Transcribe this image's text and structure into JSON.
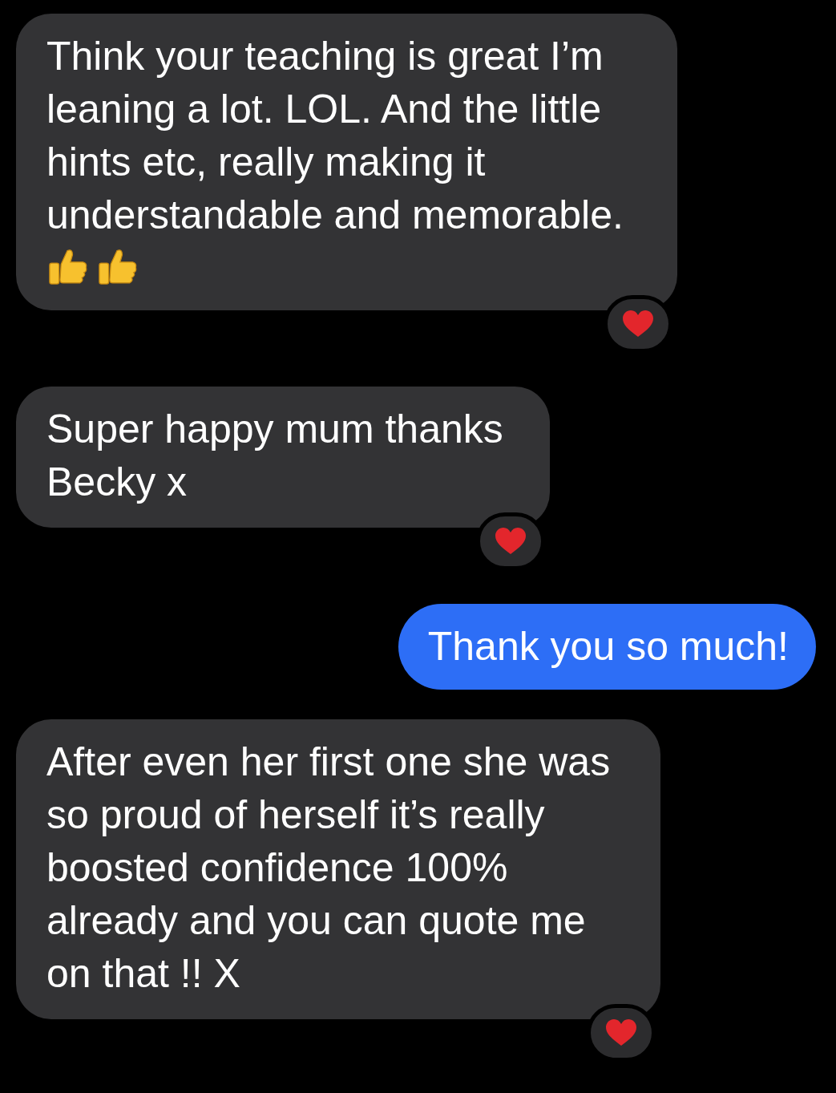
{
  "messages": [
    {
      "kind": "incoming",
      "text": "Think your teaching is great I’m leaning a lot. LOL. And the little hints etc, really making it understandable and memorable.",
      "emoji": [
        {
          "kind": "thumbs-up"
        },
        {
          "kind": "thumbs-up"
        }
      ],
      "reaction": {
        "kind": "heart"
      }
    },
    {
      "kind": "incoming",
      "text": "Super happy mum thanks Becky x",
      "reaction": {
        "kind": "heart"
      }
    },
    {
      "kind": "outgoing",
      "text": "Thank you so much!"
    },
    {
      "kind": "incoming",
      "text": "After even her first one she was so proud of herself it’s really boosted confidence 100% already and you can quote me on that !! X",
      "reaction": {
        "kind": "heart"
      }
    }
  ]
}
